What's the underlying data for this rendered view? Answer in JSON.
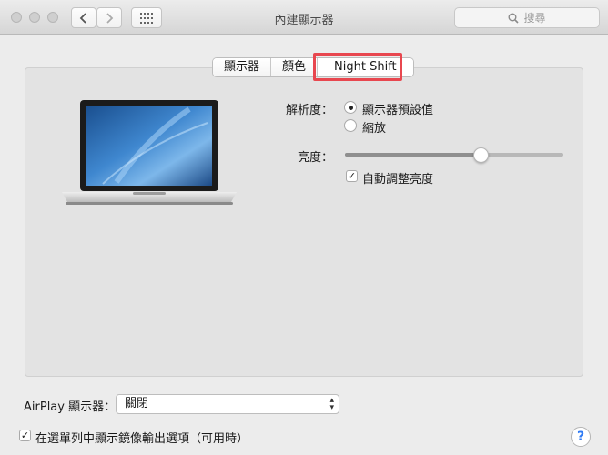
{
  "window": {
    "title": "內建顯示器",
    "search_placeholder": "搜尋"
  },
  "tabs": [
    {
      "label": "顯示器"
    },
    {
      "label": "顏色"
    },
    {
      "label": "Night Shift"
    }
  ],
  "display": {
    "resolution_label": "解析度：",
    "resolution_options": [
      {
        "label": "顯示器預設值",
        "selected": true
      },
      {
        "label": "縮放",
        "selected": false
      }
    ],
    "brightness_label": "亮度：",
    "brightness_level": 0.62,
    "auto_brightness_label": "自動調整亮度",
    "auto_brightness_checked": true
  },
  "airplay": {
    "label": "AirPlay 顯示器：",
    "value": "關閉"
  },
  "mirroring": {
    "label": "在選單列中顯示鏡像輸出選項（可用時）",
    "checked": true
  },
  "colors": {
    "highlight": "#e8474f",
    "help": "#2f7bf5"
  },
  "icons": [
    "back-icon",
    "forward-icon",
    "grid-icon",
    "search-icon",
    "help-icon",
    "laptop-image"
  ]
}
